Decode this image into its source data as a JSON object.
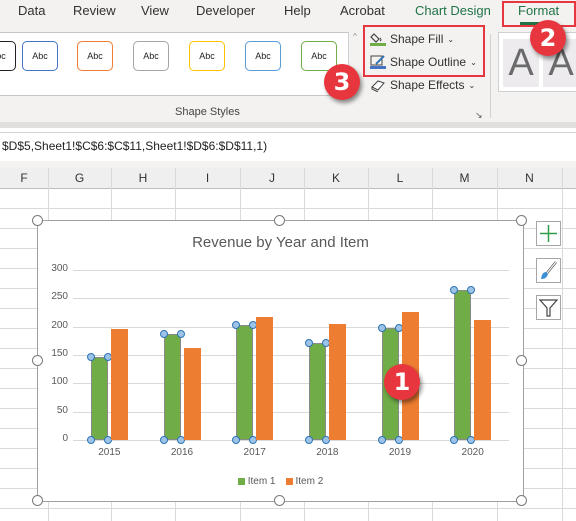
{
  "ribbon": {
    "tabs": [
      {
        "label": "Data"
      },
      {
        "label": "Review"
      },
      {
        "label": "View"
      },
      {
        "label": "Developer"
      },
      {
        "label": "Help"
      },
      {
        "label": "Acrobat"
      },
      {
        "label": "Chart Design"
      },
      {
        "label": "Format",
        "active": true
      }
    ],
    "shape_styles": {
      "gallery": [
        {
          "label": "Abc",
          "border": "#222222"
        },
        {
          "label": "Abc",
          "border": "#4472c4"
        },
        {
          "label": "Abc",
          "border": "#ed7d31"
        },
        {
          "label": "Abc",
          "border": "#a5a5a5"
        },
        {
          "label": "Abc",
          "border": "#ffc000"
        },
        {
          "label": "Abc",
          "border": "#5b9bd5"
        },
        {
          "label": "Abc",
          "border": "#70ad47"
        }
      ],
      "group_label": "Shape Styles",
      "commands": [
        {
          "label": "Shape Fill",
          "icon": "paint-bucket-icon"
        },
        {
          "label": "Shape Outline",
          "icon": "pen-outline-icon"
        },
        {
          "label": "Shape Effects",
          "icon": "shape-effects-icon"
        }
      ],
      "launcher": "↘"
    },
    "wordart": [
      "A",
      "A"
    ],
    "scroll_up": "^"
  },
  "formula_bar": {
    "text": "$D$5,Sheet1!$C$6:$C$11,Sheet1!$D$6:$D$11,1)"
  },
  "grid": {
    "columns": [
      "F",
      "G",
      "H",
      "I",
      "J",
      "K",
      "L",
      "M",
      "N"
    ]
  },
  "chart_data": {
    "type": "bar",
    "title": "Revenue by Year and Item",
    "categories": [
      "2015",
      "2016",
      "2017",
      "2018",
      "2019",
      "2020"
    ],
    "series": [
      {
        "name": "Item 1",
        "color": "#70ad47",
        "values": [
          147,
          187,
          203,
          171,
          198,
          265
        ],
        "selected": true
      },
      {
        "name": "Item 2",
        "color": "#ed7d31",
        "values": [
          196,
          162,
          217,
          205,
          226,
          212
        ]
      }
    ],
    "xlabel": "",
    "ylabel": "",
    "ylim": [
      0,
      300
    ],
    "yticks": [
      "0",
      "50",
      "100",
      "150",
      "200",
      "250",
      "300"
    ],
    "grid": true,
    "legend": "bottom"
  },
  "chart_buttons": [
    {
      "name": "chart-elements-button",
      "icon": "plus-icon"
    },
    {
      "name": "chart-styles-button",
      "icon": "brush-icon"
    },
    {
      "name": "chart-filters-button",
      "icon": "filter-icon"
    }
  ],
  "callouts": [
    "1",
    "2",
    "3"
  ]
}
